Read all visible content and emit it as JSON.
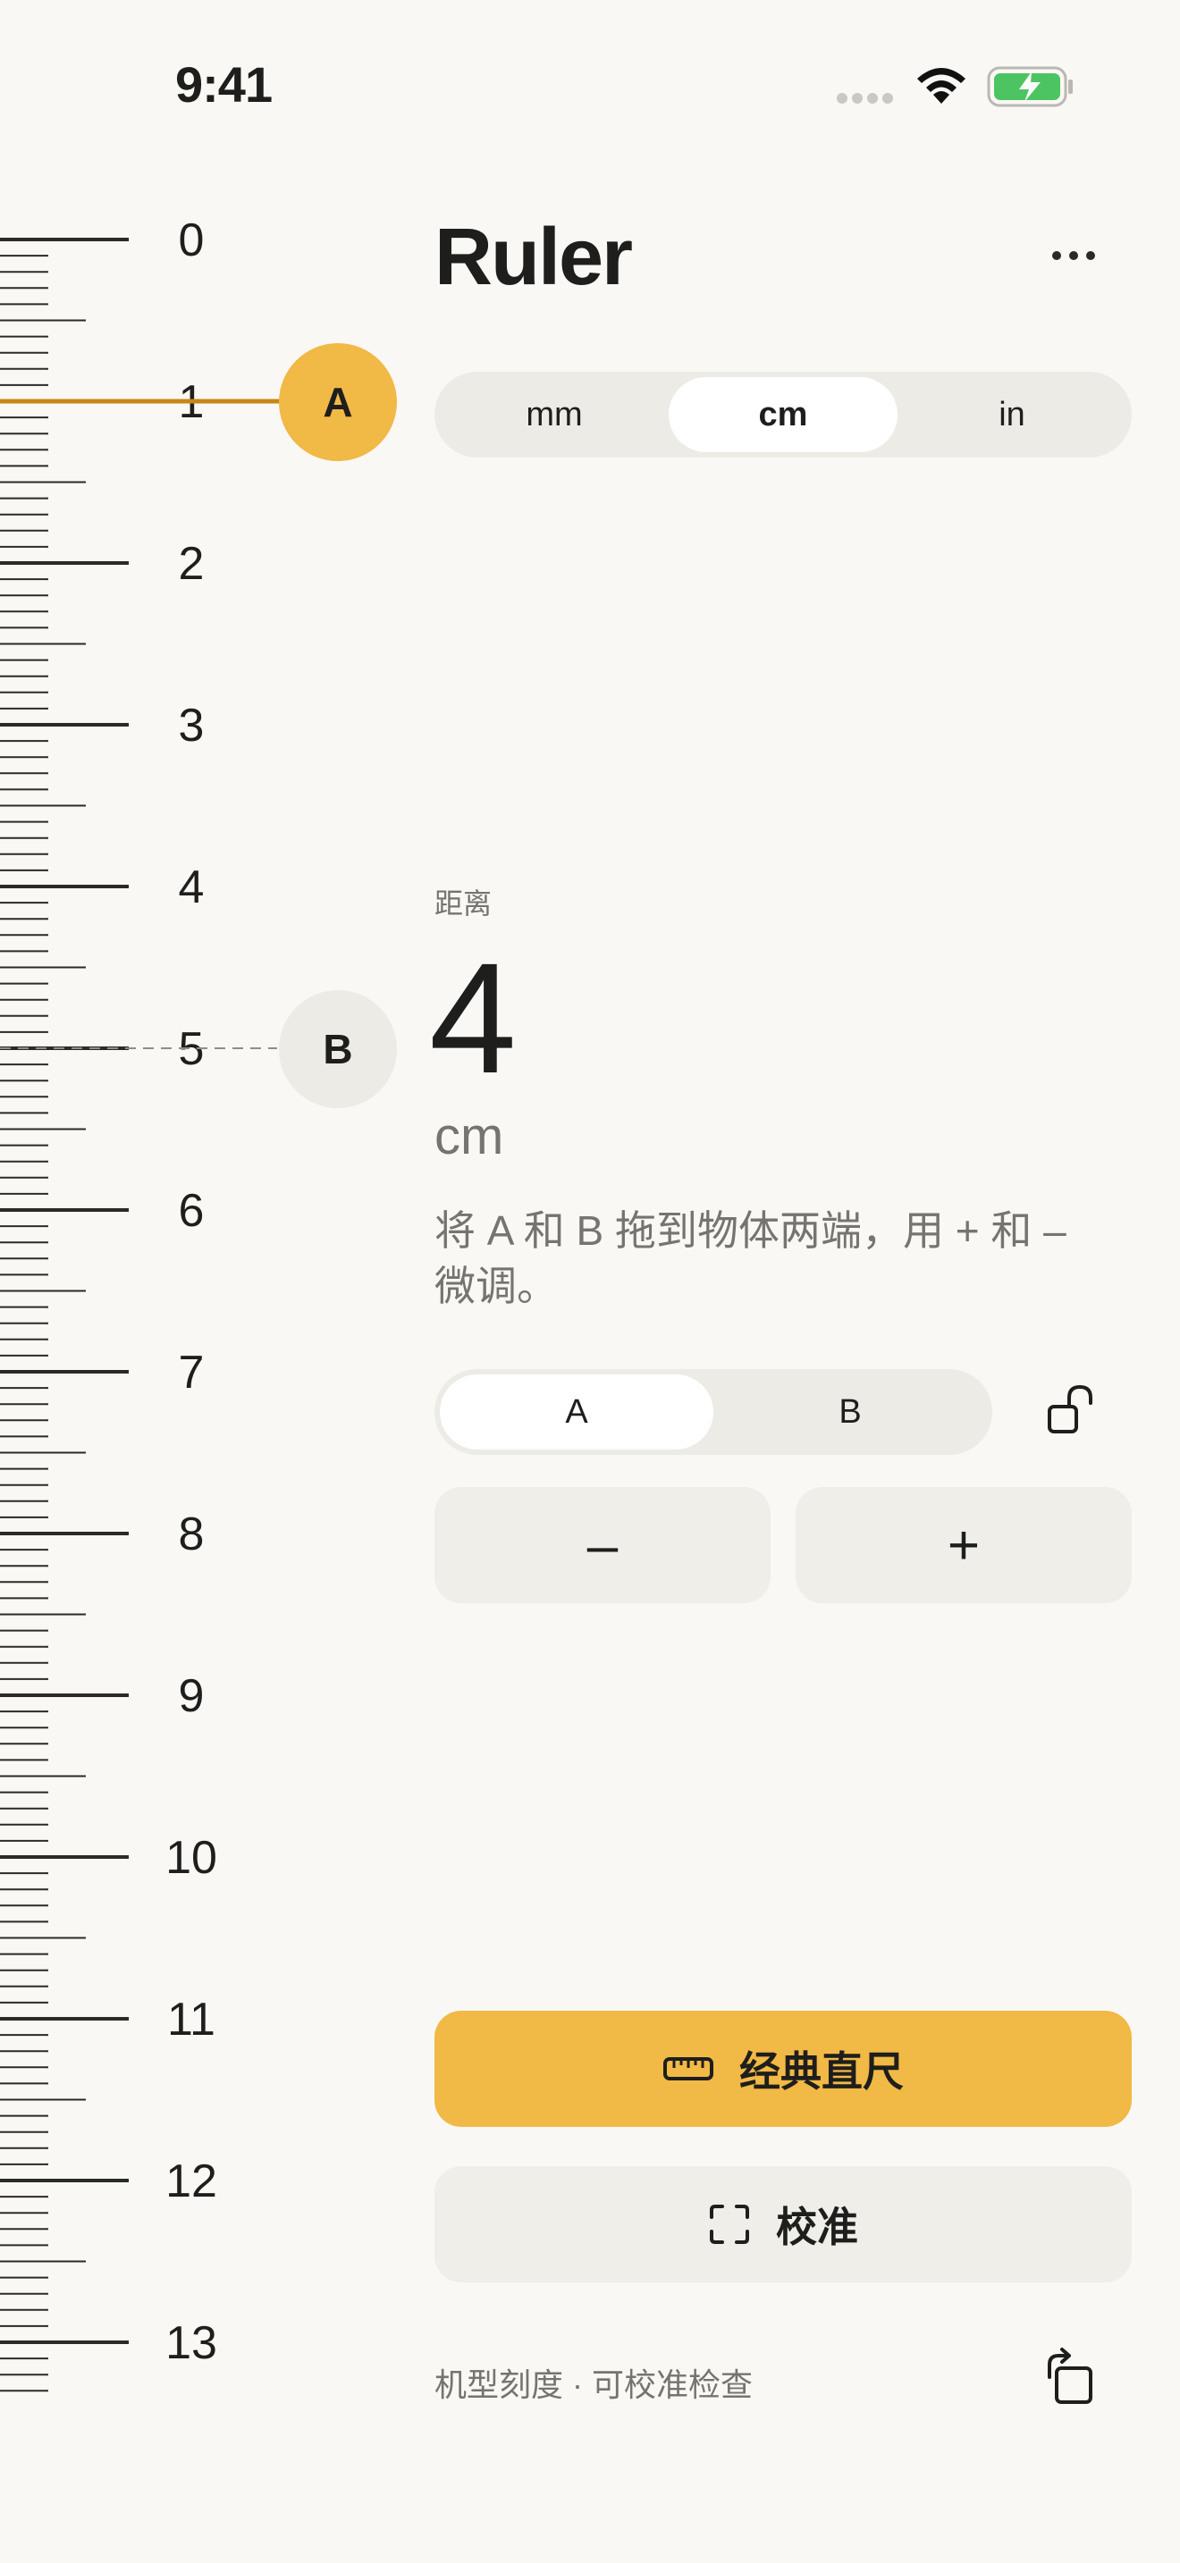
{
  "status_bar": {
    "time": "9:41"
  },
  "ruler": {
    "labels": [
      "0",
      "1",
      "2",
      "3",
      "4",
      "5",
      "6",
      "7",
      "8",
      "9",
      "10",
      "11",
      "12",
      "13"
    ],
    "unit_step": 0.1,
    "marker_a_value": 1,
    "marker_b_value": 5,
    "accent_color": "#C7861A"
  },
  "handles": {
    "a_label": "A",
    "b_label": "B"
  },
  "header": {
    "title": "Ruler",
    "more_icon": "more-horizontal-icon"
  },
  "unit_selector": {
    "options": [
      "mm",
      "cm",
      "in"
    ],
    "selected": "cm"
  },
  "distance": {
    "label": "距离",
    "value": "4",
    "unit": "cm"
  },
  "hint": "将 A 和 B 拖到物体两端，用 + 和 – 微调。",
  "point_selector": {
    "options": [
      "A",
      "B"
    ],
    "selected": "A",
    "lock_icon": "unlock-icon"
  },
  "stepper": {
    "minus_label": "–",
    "plus_label": "+"
  },
  "actions": {
    "classic_ruler_label": "经典直尺",
    "classic_ruler_icon": "ruler-icon",
    "calibrate_label": "校准",
    "calibrate_icon": "scan-frame-icon"
  },
  "footer": {
    "note": "机型刻度 · 可校准检查",
    "rotate_icon": "rotate-icon"
  },
  "colors": {
    "accent": "#F1B945",
    "background": "#F9F8F4",
    "surface": "#ECEBE6"
  }
}
